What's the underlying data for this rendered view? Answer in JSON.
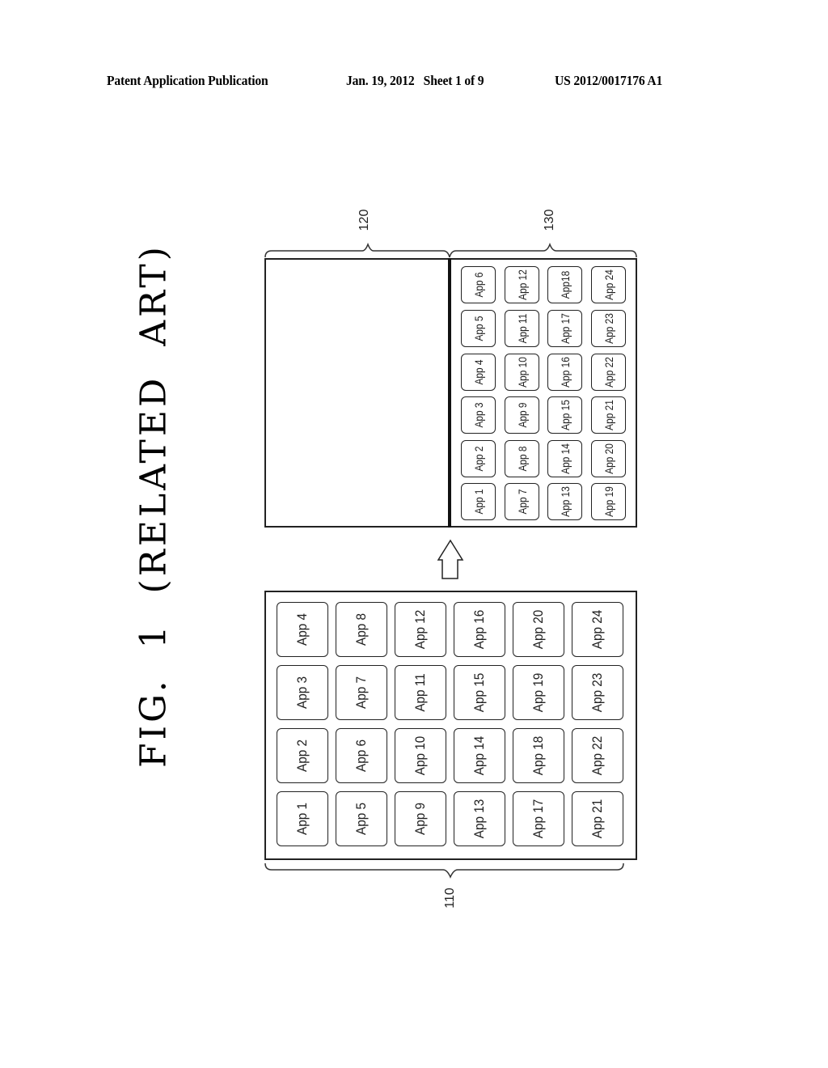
{
  "header": {
    "publication": "Patent Application Publication",
    "date_sheet": "Jan. 19, 2012   Sheet 1 of 9",
    "number": "US 2012/0017176 A1"
  },
  "figure": {
    "title": "FIG.  1  (RELATED  ART)",
    "labels": {
      "ref_110": "110",
      "ref_120": "120",
      "ref_130": "130"
    },
    "upper_panel": {
      "apps_grid_rows_top_to_bottom": [
        [
          "App 6",
          "App 12",
          "App18",
          "App 24"
        ],
        [
          "App 5",
          "App 11",
          "App 17",
          "App 23"
        ],
        [
          "App 4",
          "App 10",
          "App 16",
          "App 22"
        ],
        [
          "App 3",
          "App 9",
          "App 15",
          "App 21"
        ],
        [
          "App 2",
          "App 8",
          "App 14",
          "App 20"
        ],
        [
          "App 1",
          "App 7",
          "App 13",
          "App 19"
        ]
      ]
    },
    "lower_panel": {
      "apps_grid_rows_top_to_bottom": [
        [
          "App 4",
          "App 8",
          "App 12",
          "App 16",
          "App 20",
          "App 24"
        ],
        [
          "App 3",
          "App 7",
          "App 11",
          "App 15",
          "App 19",
          "App 23"
        ],
        [
          "App 2",
          "App 6",
          "App 10",
          "App 14",
          "App 18",
          "App 22"
        ],
        [
          "App 1",
          "App 5",
          "App 9",
          "App 13",
          "App 17",
          "App 21"
        ]
      ]
    },
    "arrow_icon": "up-arrow-icon"
  }
}
